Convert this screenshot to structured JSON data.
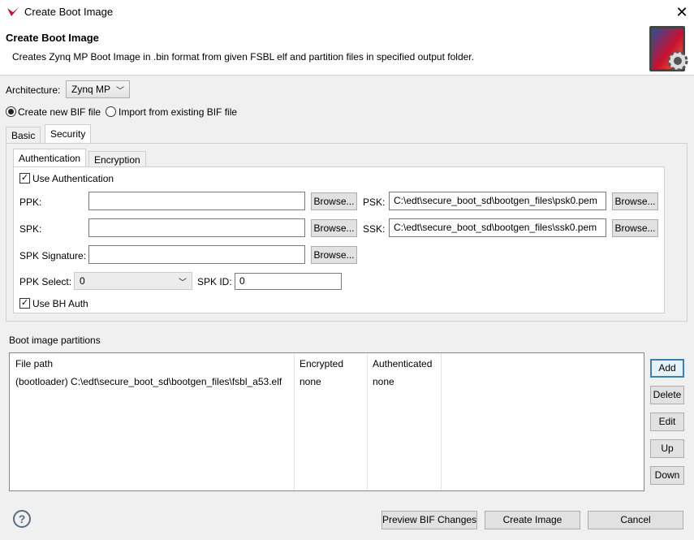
{
  "window": {
    "title": "Create Boot Image"
  },
  "header": {
    "title": "Create Boot Image",
    "description": "Creates Zynq MP Boot Image in .bin format from given FSBL elf and partition files in specified output folder."
  },
  "architecture": {
    "label": "Architecture:",
    "value": "Zynq MP"
  },
  "bif_mode": {
    "options": [
      {
        "label": "Create new BIF file",
        "selected": true
      },
      {
        "label": "Import from existing BIF file",
        "selected": false
      }
    ]
  },
  "tabs": [
    {
      "label": "Basic",
      "active": false
    },
    {
      "label": "Security",
      "active": true
    }
  ],
  "subtabs": [
    {
      "label": "Authentication",
      "active": true
    },
    {
      "label": "Encryption",
      "active": false
    }
  ],
  "auth": {
    "use_auth": {
      "label": "Use Authentication",
      "checked": true
    },
    "ppk": {
      "label": "PPK:",
      "value": ""
    },
    "spk": {
      "label": "SPK:",
      "value": ""
    },
    "spk_signature": {
      "label": "SPK Signature:",
      "value": ""
    },
    "psk": {
      "label": "PSK:",
      "value": "C:\\edt\\secure_boot_sd\\bootgen_files\\psk0.pem"
    },
    "ssk": {
      "label": "SSK:",
      "value": "C:\\edt\\secure_boot_sd\\bootgen_files\\ssk0.pem"
    },
    "browse_label": "Browse...",
    "ppk_select": {
      "label": "PPK Select:",
      "value": "0"
    },
    "spk_id": {
      "label": "SPK ID:",
      "value": "0"
    },
    "use_bh_auth": {
      "label": "Use BH Auth",
      "checked": true
    }
  },
  "partitions": {
    "title": "Boot image partitions",
    "columns": [
      "File path",
      "Encrypted",
      "Authenticated"
    ],
    "rows": [
      {
        "file_path": "(bootloader) C:\\edt\\secure_boot_sd\\bootgen_files\\fsbl_a53.elf",
        "encrypted": "none",
        "authenticated": "none"
      }
    ],
    "buttons": {
      "add": "Add",
      "delete": "Delete",
      "edit": "Edit",
      "up": "Up",
      "down": "Down"
    }
  },
  "footer": {
    "help": "?",
    "preview": "Preview BIF Changes",
    "create": "Create Image",
    "cancel": "Cancel"
  },
  "colors": {
    "accent": "#3c7fb1",
    "brand_red": "#c8102e"
  }
}
